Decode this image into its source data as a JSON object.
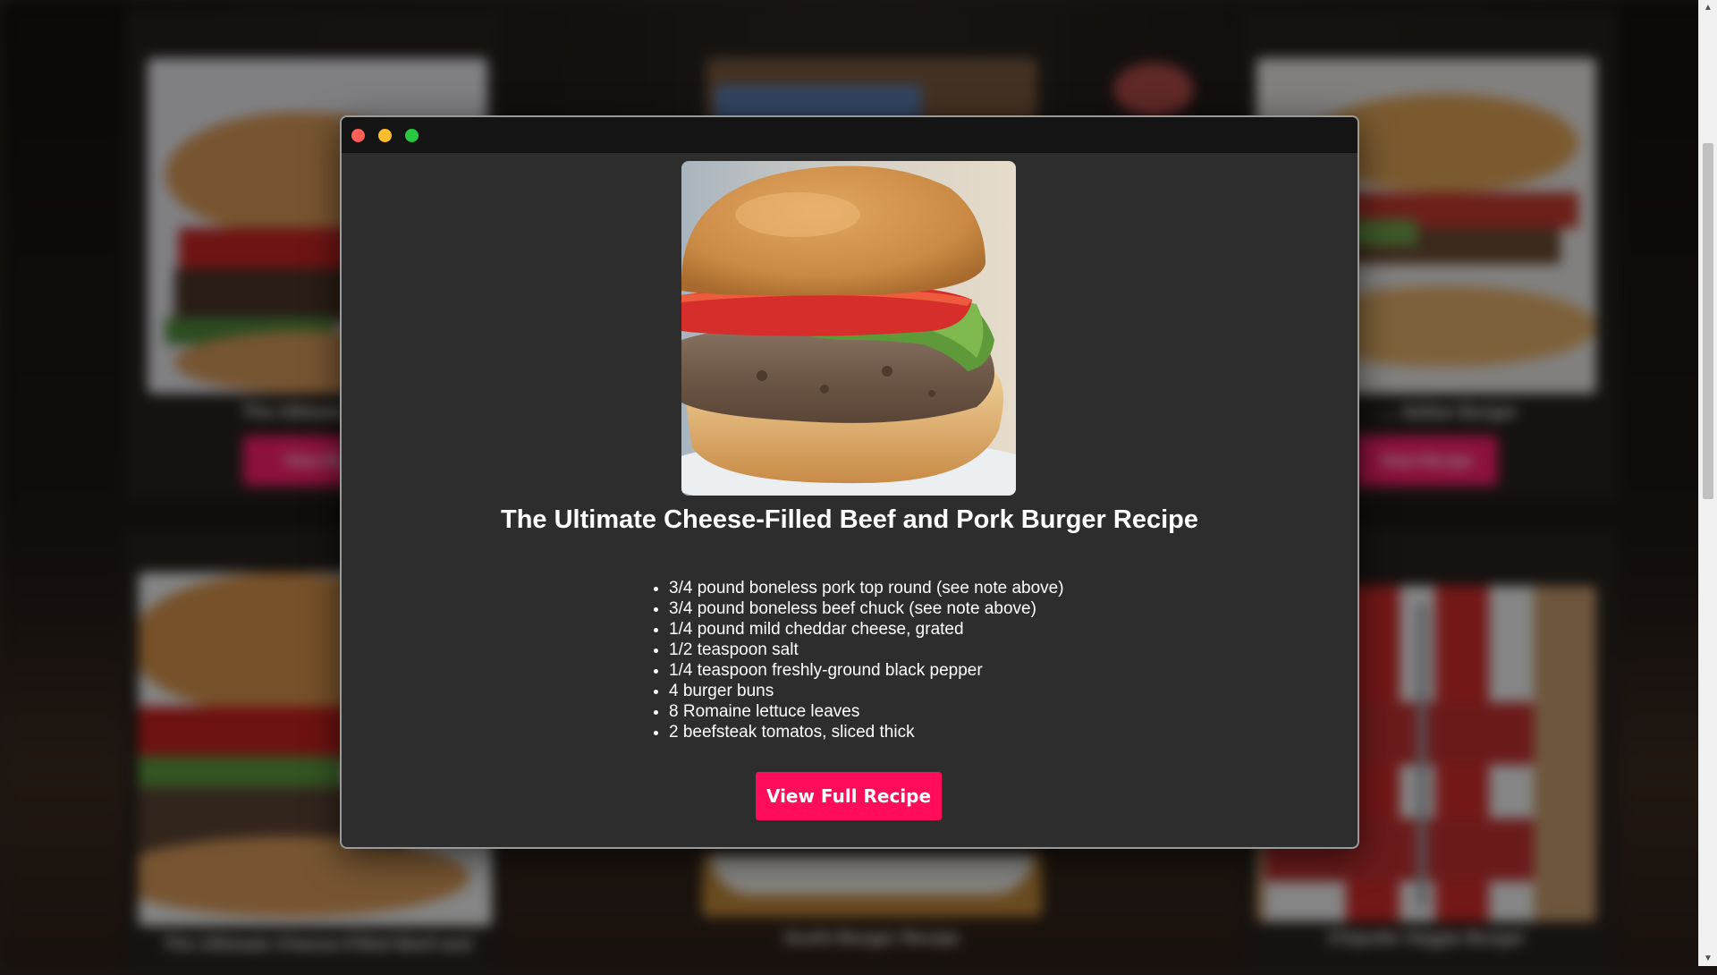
{
  "modal": {
    "window_controls": [
      "close",
      "minimize",
      "maximize"
    ],
    "title": "The Ultimate Cheese-Filled Beef and Pork Burger Recipe",
    "ingredients": [
      "3/4 pound boneless pork top round (see note above)",
      "3/4 pound boneless beef chuck (see note above)",
      "1/4 pound mild cheddar cheese, grated",
      "1/2 teaspoon salt",
      "1/4 teaspoon freshly-ground black pepper",
      "4 burger buns",
      "8 Romaine lettuce leaves",
      "2 beefsteak tomatos, sliced thick"
    ],
    "cta_label": "View Full Recipe"
  },
  "background_cards": [
    {
      "caption": "The Ultimate",
      "button_label": "View Re"
    },
    {
      "caption": "… Italian Burger",
      "button_label": "View Recipe"
    },
    {
      "caption": "The Ultimate Cheese-Filled Beef and",
      "button_label": ""
    },
    {
      "caption": "Sushi Burger Recipe",
      "button_label": ""
    },
    {
      "caption": "Chipotle Veggie Burger",
      "button_label": ""
    }
  ],
  "colors": {
    "accent": "#ff0c5a",
    "modal_bg": "#2d2d2d",
    "titlebar_bg": "#141414"
  }
}
